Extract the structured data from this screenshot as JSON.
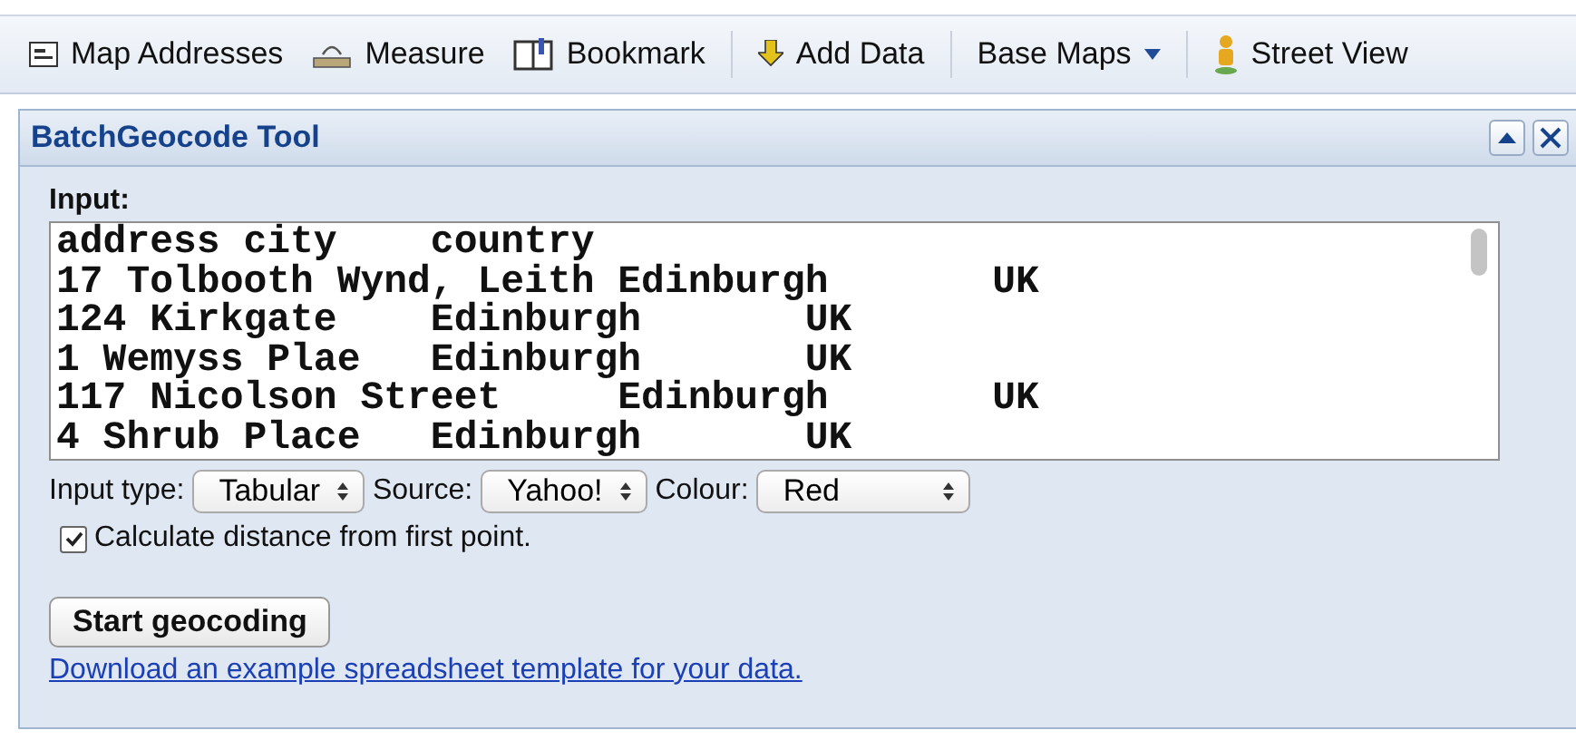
{
  "toolbar": [
    {
      "kind": "addresses",
      "label": "Map Addresses"
    },
    {
      "kind": "measure",
      "label": "Measure"
    },
    {
      "kind": "bookmark",
      "label": "Bookmark"
    },
    {
      "kind": "divider"
    },
    {
      "kind": "add",
      "label": "Add Data"
    },
    {
      "kind": "divider"
    },
    {
      "kind": "dropdown",
      "label": "Base Maps"
    },
    {
      "kind": "divider"
    },
    {
      "kind": "person",
      "label": "Street View"
    }
  ],
  "panel": {
    "title": "BatchGeocode Tool",
    "input_label": "Input:",
    "input_lines": [
      "address city    country",
      "17 Tolbooth Wynd, Leith Edinburgh       UK",
      "124 Kirkgate    Edinburgh       UK",
      "1 Wemyss Plae   Edinburgh       UK",
      "117 Nicolson Street     Edinburgh       UK",
      "4 Shrub Place   Edinburgh       UK"
    ],
    "selects": [
      {
        "label": "Input type:",
        "value": "Tabular"
      },
      {
        "label": "Source:",
        "value": "Yahoo!"
      },
      {
        "label": "Colour:",
        "value": "Red"
      }
    ],
    "checkbox": {
      "label": "Calculate distance from first point.",
      "checked": true
    },
    "button": "Start geocoding",
    "link": "Download an example spreadsheet template for your data."
  }
}
